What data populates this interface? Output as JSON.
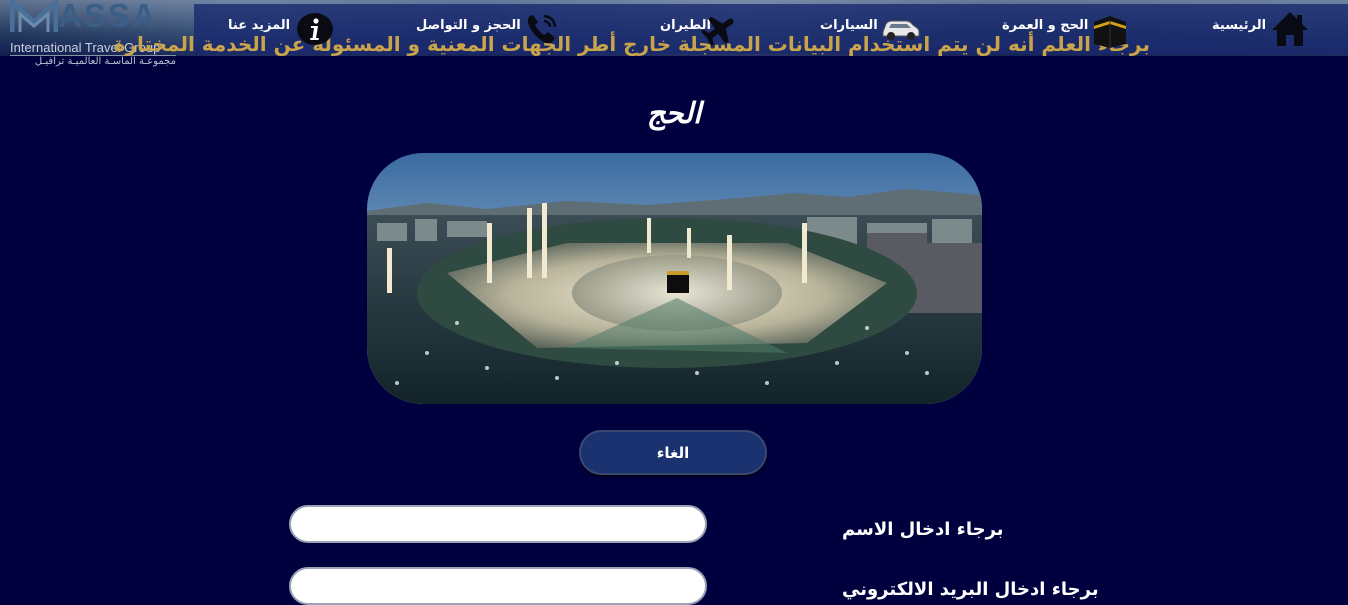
{
  "brand": {
    "name": "ASSA",
    "tagline": "International Travel Group",
    "arabic_tagline": "مجموعـة الماسـة العالميـة ترافيـل"
  },
  "notice": "برجاء العلم أنه لن يتم استخدام البيانات المسجلة خارج أطر الجهات المعنية و المسئولة عن الخدمة المختارة",
  "nav": {
    "home": {
      "label": "الرئيسية",
      "icon": "house-icon"
    },
    "hajj_umrah": {
      "label": "الحج و العمرة",
      "icon": "kaaba-icon"
    },
    "cars": {
      "label": "السيارات",
      "icon": "car-icon"
    },
    "flights": {
      "label": "الطيران",
      "icon": "airplane-icon"
    },
    "booking": {
      "label": "الحجز و التواصل",
      "icon": "phone-icon"
    },
    "about": {
      "label": "المزيد عنا",
      "icon": "info-icon"
    }
  },
  "page": {
    "title": "الحج"
  },
  "actions": {
    "cancel_label": "الغاء"
  },
  "form": {
    "name_label": "برجاء ادخال الاسم",
    "name_value": "",
    "email_label": "برجاء ادخال البريد الالكتروني",
    "email_value": ""
  },
  "colors": {
    "background": "#01003f",
    "navbar": "#18286e",
    "notice_text": "#c9a44a",
    "button": "#1b3270"
  }
}
